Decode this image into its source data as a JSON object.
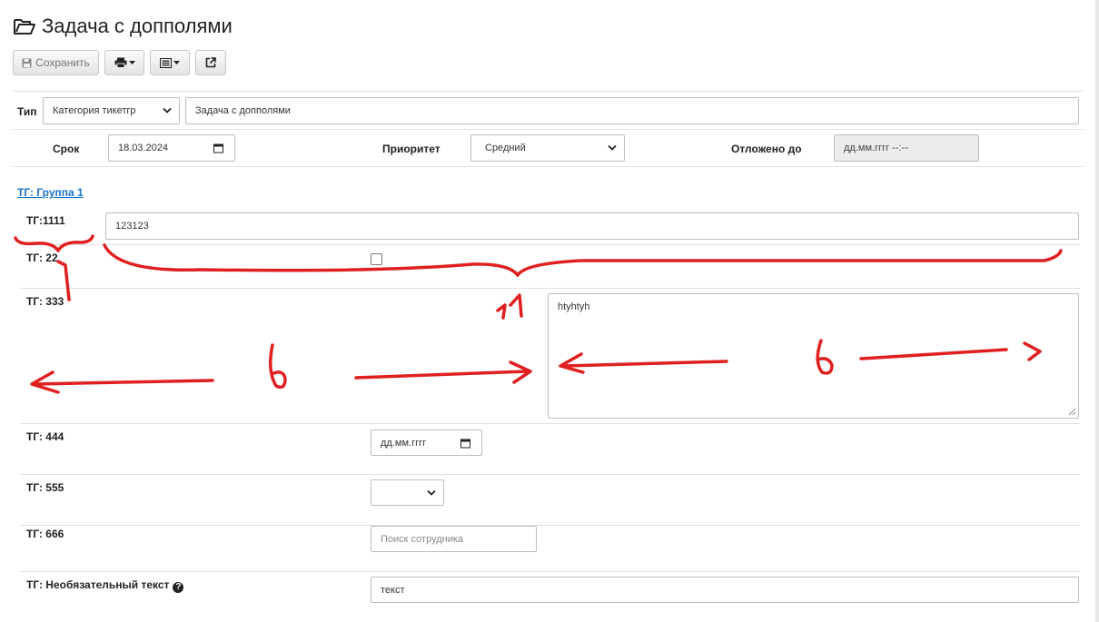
{
  "page": {
    "title": "Задача с допполями"
  },
  "toolbar": {
    "save_label": "Сохранить"
  },
  "type_row": {
    "label": "Тип",
    "category_value": "Категория тикетгр",
    "name_value": "Задача с допполями"
  },
  "meta_row": {
    "due_label": "Срок",
    "due_value": "18.03.2024",
    "priority_label": "Приоритет",
    "priority_value": "Средний",
    "postponed_label": "Отложено до",
    "postponed_value": "дд.мм.гггг --:--"
  },
  "group": {
    "title": "ТГ: Группа 1"
  },
  "fields": {
    "f1111": {
      "label": "ТГ:1111",
      "value": "123123"
    },
    "f222": {
      "label": "ТГ: 22"
    },
    "f333": {
      "label": "ТГ: 333",
      "required_mark": "*",
      "value": "htyhtyh"
    },
    "f444": {
      "label": "ТГ: 444",
      "value": "дд.мм.гггг"
    },
    "f555": {
      "label": "ТГ: 555",
      "value": ""
    },
    "f666": {
      "label": "ТГ: 666",
      "placeholder": "Поиск сотрудника"
    },
    "optional": {
      "label": "ТГ: Необязательный текст",
      "help_glyph": "?",
      "value": "текст"
    }
  },
  "annotations": {
    "label_1": "1",
    "label_11": "11",
    "label_6a": "6",
    "label_6b": "6",
    "color": "#e02020"
  },
  "colors": {
    "link": "#1a73c9",
    "border": "#bdbdbd",
    "disabled_bg": "#ececec"
  }
}
